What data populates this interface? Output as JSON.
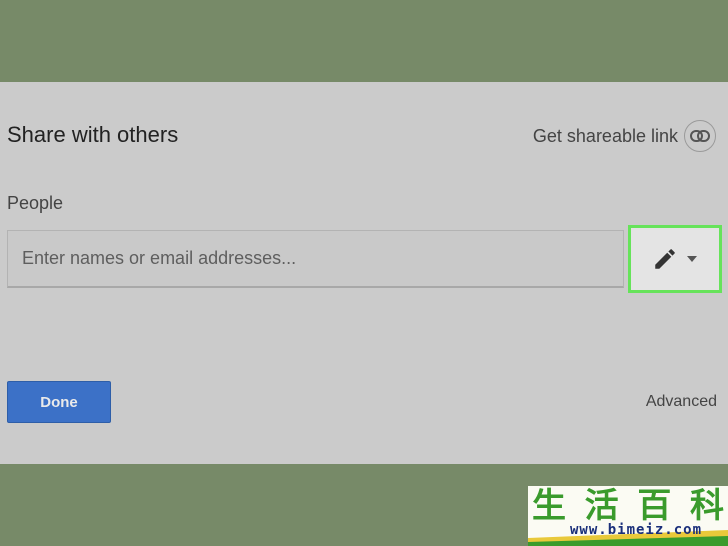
{
  "dialog": {
    "title": "Share with others",
    "share_link_label": "Get shareable link",
    "people_label": "People",
    "email_placeholder": "Enter names or email addresses...",
    "email_value": "",
    "done_label": "Done",
    "advanced_label": "Advanced"
  },
  "icons": {
    "link": "link-icon",
    "permission": "pencil-icon",
    "dropdown": "caret-down-icon"
  },
  "colors": {
    "background": "#778a68",
    "dialog": "#cbcbcb",
    "done_button": "#3c71c7",
    "highlight": "#66e35a"
  },
  "watermark": {
    "characters": [
      "生",
      "活",
      "百",
      "科"
    ],
    "url": "www.bimeiz.com"
  }
}
